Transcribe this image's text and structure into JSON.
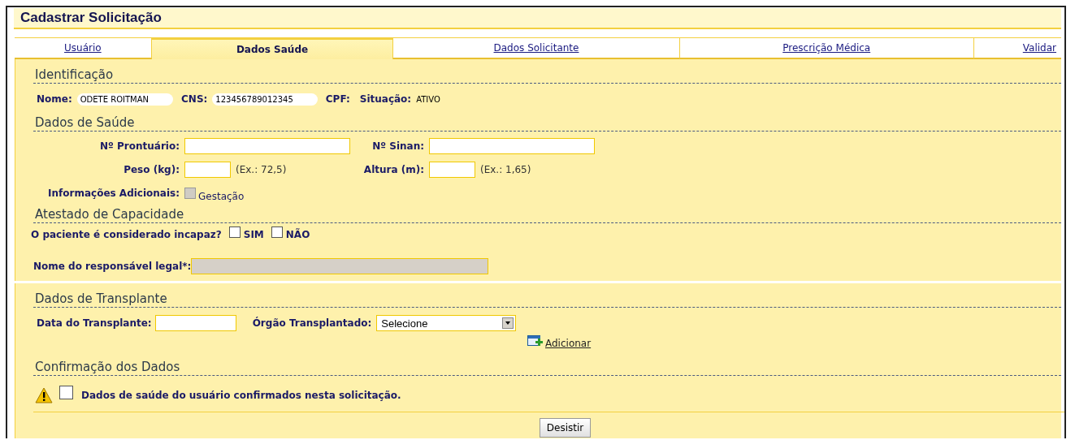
{
  "title": "Cadastrar Solicitação",
  "tabs": [
    {
      "label": "Usuário",
      "selected": false
    },
    {
      "label": "Dados Saúde",
      "selected": true
    },
    {
      "label": "Dados Solicitante",
      "selected": false
    },
    {
      "label": "Prescrição Médica",
      "selected": false
    },
    {
      "label": "Validar",
      "selected": false
    }
  ],
  "identificacao": {
    "heading": "Identificação",
    "fields": [
      {
        "label": "Nome:",
        "value": "ODETE ROITMAN"
      },
      {
        "label": "CNS:",
        "value": "123456789012345"
      },
      {
        "label": "CPF:"
      },
      {
        "label": "Situação:",
        "value": "ATIVO"
      }
    ]
  },
  "dados_saude": {
    "heading": "Dados de Saúde",
    "rows": [
      {
        "left": {
          "label": "Nº Prontuário:",
          "kind": "long"
        },
        "right": {
          "label": "Nº Sinan:",
          "kind": "long"
        }
      },
      {
        "left": {
          "label": "Peso (kg):",
          "kind": "short",
          "hint": "(Ex.: 72,5)"
        },
        "right": {
          "label": "Altura (m):",
          "kind": "short",
          "hint": "(Ex.: 1,65)"
        }
      }
    ],
    "extra": {
      "label": "Informações Adicionais:",
      "option": "Gestação",
      "checked": false,
      "disabled": true
    }
  },
  "atestado": {
    "heading": "Atestado de Capacidade",
    "question": "O paciente é considerado incapaz?",
    "options": [
      {
        "label": "SIM",
        "checked": false
      },
      {
        "label": "NÃO",
        "checked": false
      }
    ],
    "responsavel": {
      "label": "Nome do responsável legal*:",
      "disabled": true
    }
  },
  "transplante": {
    "heading": "Dados de Transplante",
    "date_label": "Data do Transplante:",
    "organ_label": "Órgão Transplantado:",
    "organ_value": "Selecione",
    "add_link": "Adicionar"
  },
  "confirmacao": {
    "heading": "Confirmação dos Dados",
    "text": "Dados de saúde do usuário confirmados nesta solicitação.",
    "checked": false
  },
  "button": "Desistir"
}
